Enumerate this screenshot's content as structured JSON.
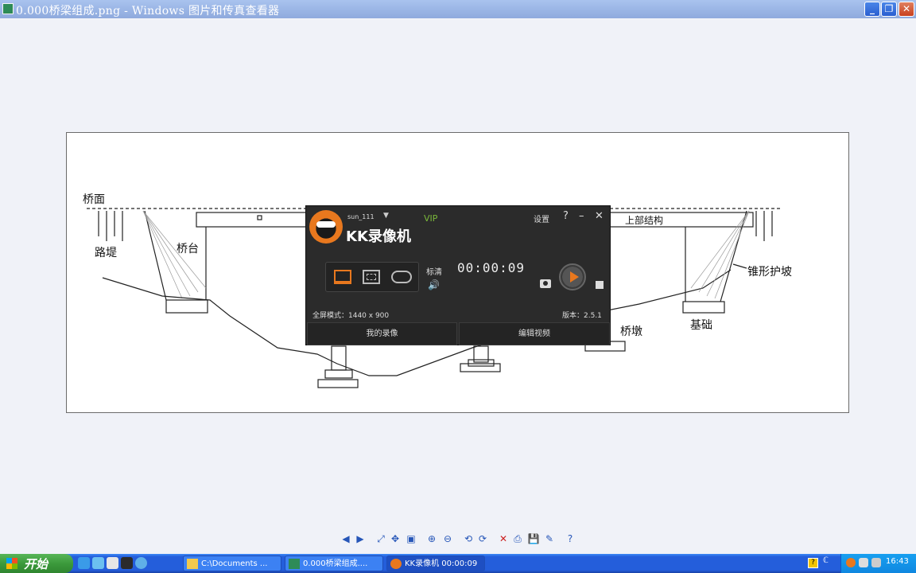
{
  "window": {
    "title": "0.000桥梁组成.png - Windows 图片和传真查看器",
    "minimize_glyph": "_",
    "maximize_glyph": "❐",
    "close_glyph": "✕"
  },
  "diagram": {
    "labels": {
      "deck": "桥面",
      "embankment": "路堤",
      "abutment": "桥台",
      "superstructure": "上部结构",
      "cone_slope": "锥形护坡",
      "pier": "桥墩",
      "foundation": "基础"
    }
  },
  "kk_recorder": {
    "username": "sun_111",
    "vip": "VIP",
    "settings": "设置",
    "help": "?",
    "minimize": "–",
    "close": "✕",
    "app_name": "KK录像机",
    "quality": "标清",
    "timer": "00:00:09",
    "mode_text": "全屏模式：1440 x 900",
    "version": "版本：2.5.1",
    "tabs": [
      "我的录像",
      "编辑视频"
    ],
    "accent": "#e8781e",
    "icons": [
      "screen-mode-icon",
      "region-mode-icon",
      "game-mode-icon",
      "volume-icon",
      "camera-icon",
      "record-icon",
      "stop-icon"
    ]
  },
  "viewer_toolbar": {
    "buttons": [
      "◀",
      "▶",
      "⤢",
      "✥",
      "▣",
      "⊕",
      "⊖",
      "⟲",
      "⟳",
      "✕",
      "⎙",
      "💾",
      "✎",
      "?"
    ]
  },
  "taskbar": {
    "start_label": "开始",
    "tasks": [
      {
        "label": "C:\\Documents ..."
      },
      {
        "label": "0.000桥梁组成...."
      },
      {
        "label": "KK录像机 00:00:09"
      }
    ],
    "clock": "16:43",
    "help_glyph": "?"
  }
}
